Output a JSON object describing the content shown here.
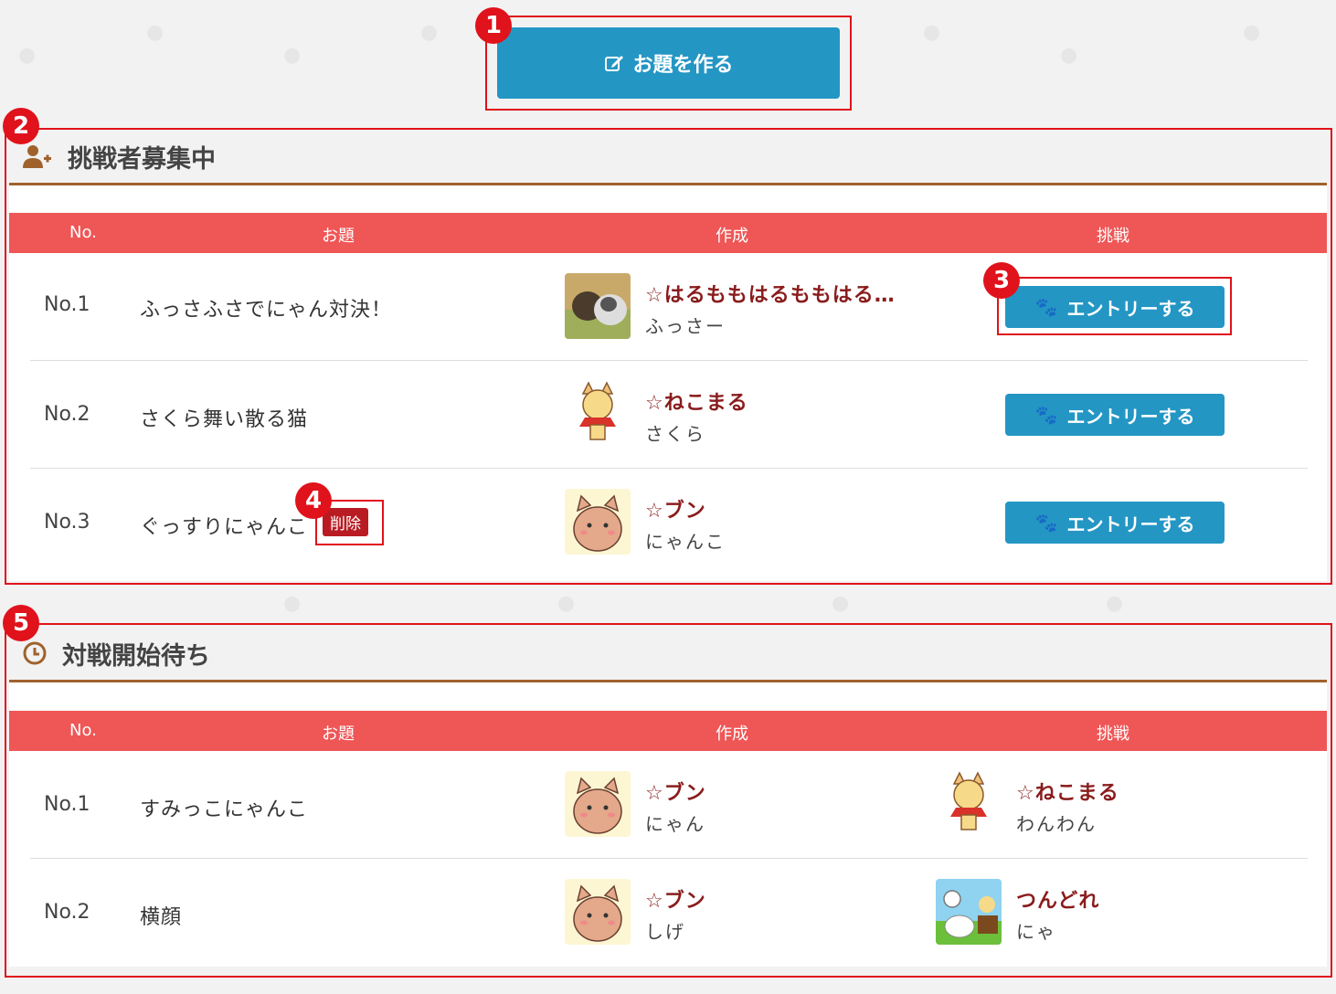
{
  "markers": [
    "1",
    "2",
    "3",
    "4",
    "5"
  ],
  "create_button": {
    "label": "お題を作る",
    "icon": "edit-icon"
  },
  "recruiting": {
    "title": "挑戦者募集中",
    "icon": "user-plus-icon",
    "columns": {
      "no": "No.",
      "topic": "お題",
      "creator": "作成",
      "challenge": "挑戦"
    },
    "rows": [
      {
        "no": "No.1",
        "topic": "ふっさふさでにゃん対決！",
        "creator": "☆はるももはるももはる…",
        "creator_sub": "ふっさー",
        "avatar": "photo-cats",
        "action": "エントリーする"
      },
      {
        "no": "No.2",
        "topic": "さくら舞い散る猫",
        "creator": "☆ねこまる",
        "creator_sub": "さくら",
        "avatar": "cat-cape",
        "action": "エントリーする"
      },
      {
        "no": "No.3",
        "topic": "ぐっすりにゃんこ",
        "creator": "☆ブン",
        "creator_sub": "にゃんこ",
        "avatar": "cat-wave",
        "action": "エントリーする",
        "delete": "削除"
      }
    ]
  },
  "waiting": {
    "title": "対戦開始待ち",
    "icon": "clock-icon",
    "columns": {
      "no": "No.",
      "topic": "お題",
      "creator": "作成",
      "challenge": "挑戦"
    },
    "rows": [
      {
        "no": "No.1",
        "topic": "すみっこにゃんこ",
        "creator": "☆ブン",
        "creator_sub": "にゃん",
        "challenger": "☆ねこまる",
        "challenger_sub": "わんわん"
      },
      {
        "no": "No.2",
        "topic": "横顔",
        "creator": "☆ブン",
        "creator_sub": "しげ",
        "challenger": "つんどれ",
        "challenger_sub": "にゃ"
      }
    ]
  },
  "colors": {
    "accent_blue": "#2496c4",
    "header_red": "#ef5656",
    "brown": "#a0622d",
    "name_red": "#8a1c1c",
    "marker_red": "#e0121b"
  }
}
